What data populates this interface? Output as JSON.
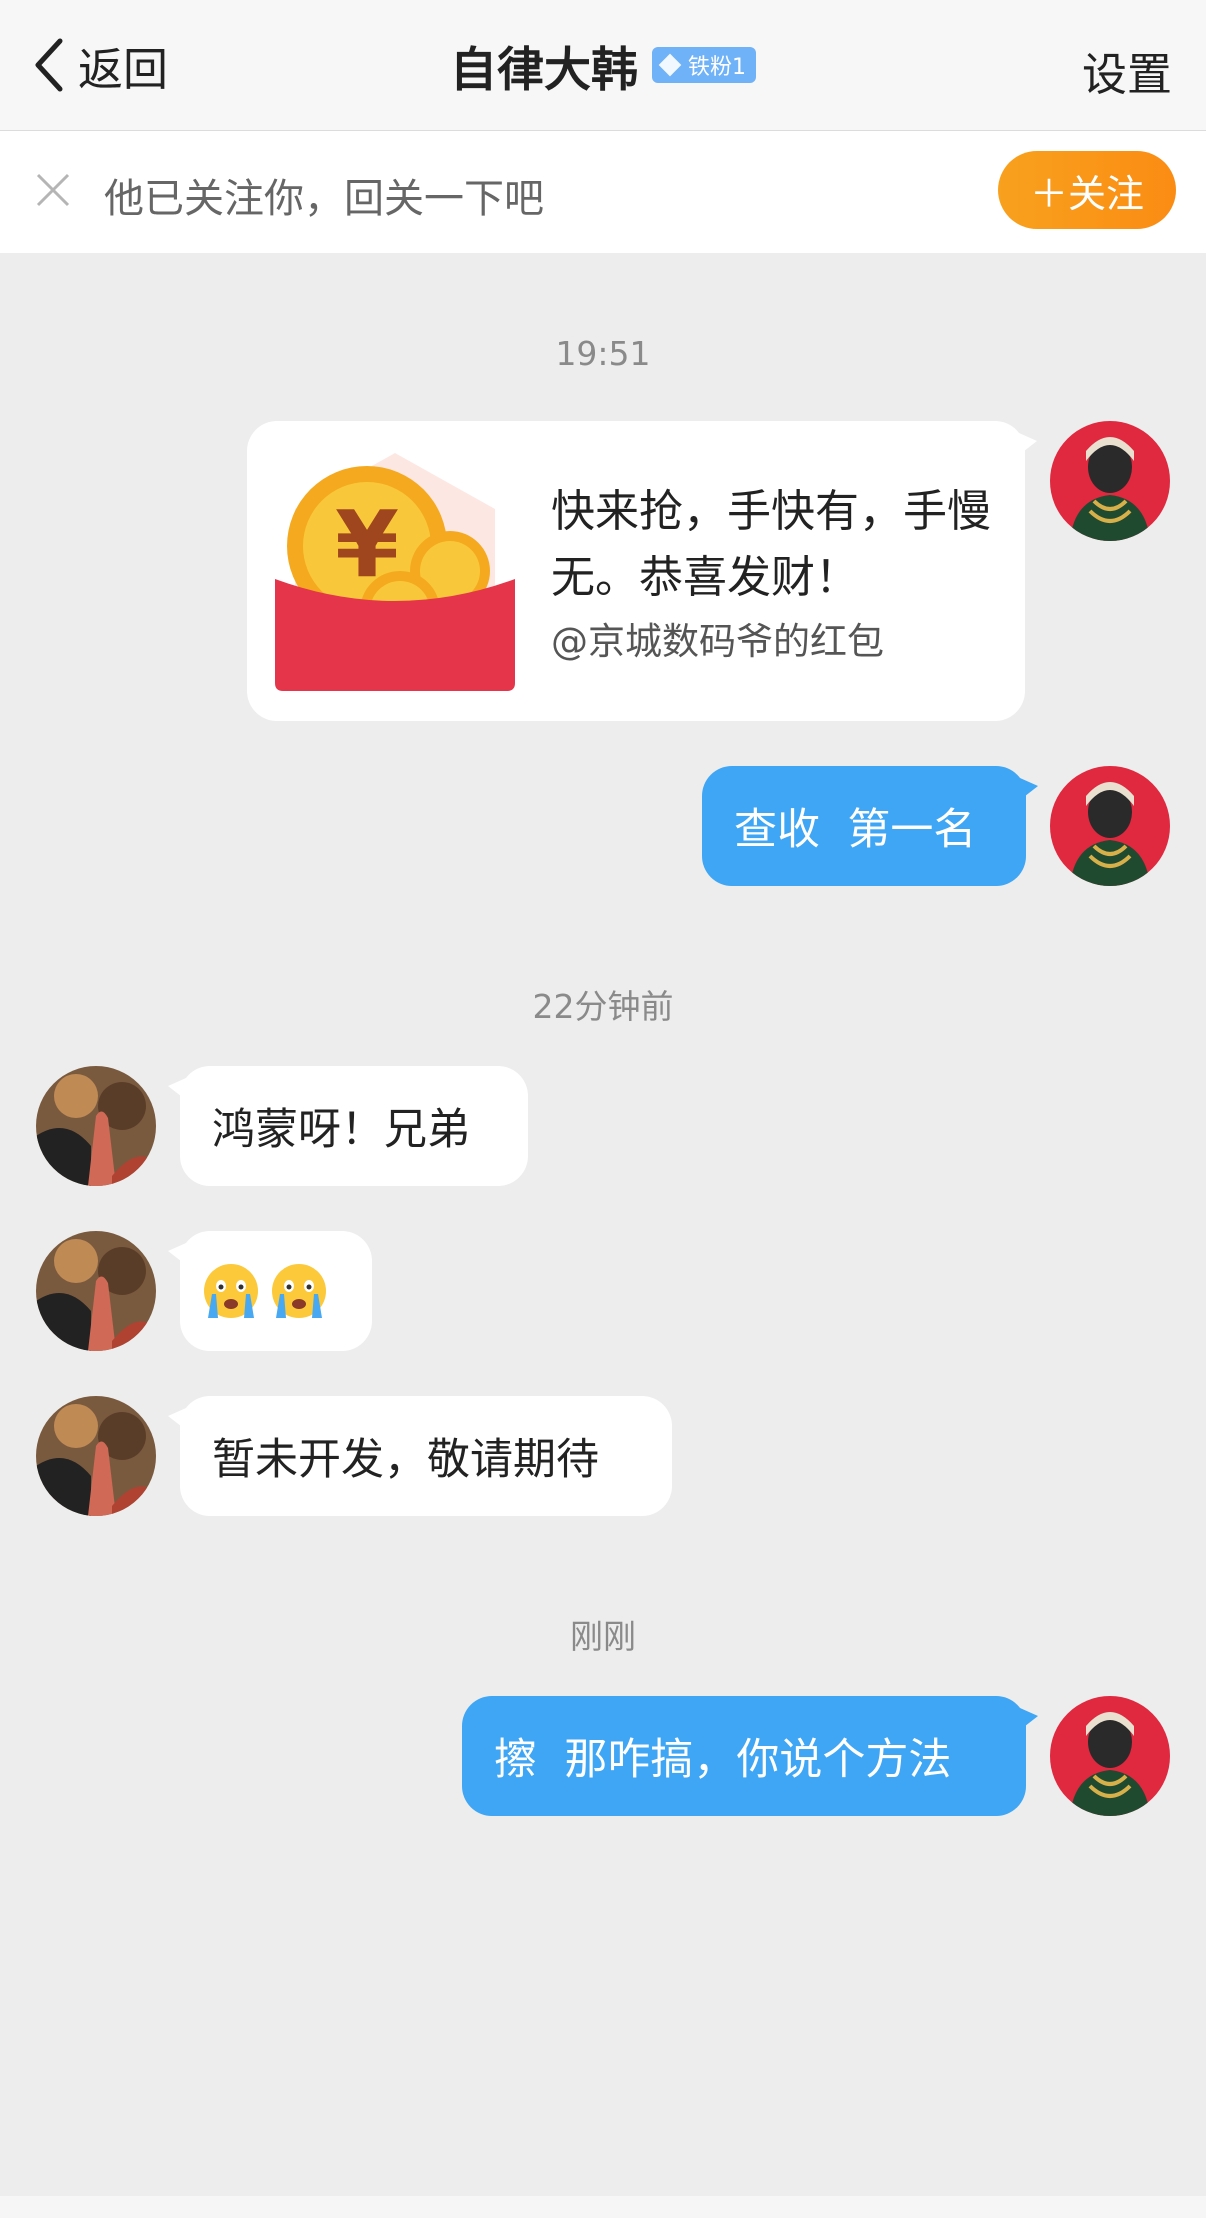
{
  "nav": {
    "back_label": "返回",
    "title": "自律大韩",
    "fan_badge": "铁粉1",
    "settings_label": "设置"
  },
  "follow_bar": {
    "text": "他已关注你，回关一下吧",
    "button_label": "＋关注"
  },
  "messages": [
    {
      "type": "timestamp",
      "text": "19:51"
    },
    {
      "type": "red_packet",
      "direction": "out",
      "text": "快来抢，手快有，手慢无。恭喜发财！",
      "from": "@京城数码爷的红包"
    },
    {
      "type": "text",
      "direction": "out",
      "text": "查收  第一名"
    },
    {
      "type": "timestamp",
      "text": "22分钟前"
    },
    {
      "type": "text",
      "direction": "in",
      "text": "鸿蒙呀！兄弟"
    },
    {
      "type": "emoji",
      "direction": "in",
      "emojis": [
        "crying-face-icon",
        "crying-face-icon"
      ]
    },
    {
      "type": "text",
      "direction": "in",
      "text": "暂未开发，敬请期待"
    },
    {
      "type": "timestamp",
      "text": "刚刚"
    },
    {
      "type": "text",
      "direction": "out",
      "text": "擦  那咋搞，你说个方法"
    }
  ],
  "colors": {
    "outgoing_bubble": "#3ea6f5",
    "follow_button": "#fb8c13",
    "fan_badge": "#6fb2f7",
    "background": "#ededed"
  }
}
